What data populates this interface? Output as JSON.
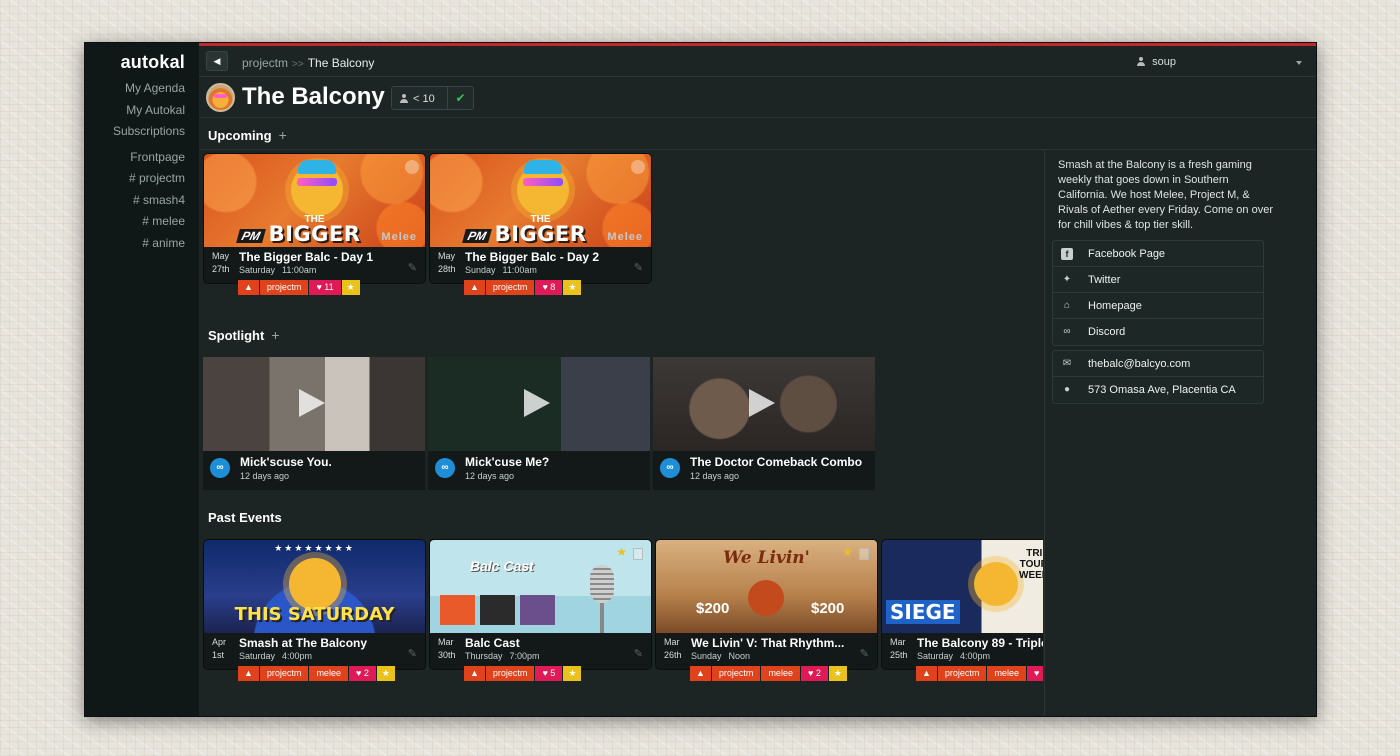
{
  "sidebar": {
    "logo": "autokal",
    "nav": [
      "My Agenda",
      "My Autokal",
      "Subscriptions"
    ],
    "front": "Frontpage",
    "channels": [
      "# projectm",
      "# smash4",
      "# melee",
      "# anime"
    ]
  },
  "topbar": {
    "breadcrumb_parent": "projectm",
    "breadcrumb_sep": ">>",
    "breadcrumb_current": "The Balcony",
    "user": "soup"
  },
  "header": {
    "title": "The Balcony",
    "members": "< 10"
  },
  "sections": {
    "upcoming": "Upcoming",
    "spotlight": "Spotlight",
    "past": "Past Events",
    "plus": "+"
  },
  "upcoming": [
    {
      "month": "May",
      "day": "27th",
      "title": "The Bigger Balc - Day 1",
      "weekday": "Saturday",
      "time": "11:00am",
      "tags": [
        "projectm"
      ],
      "likes": "11"
    },
    {
      "month": "May",
      "day": "28th",
      "title": "The Bigger Balc - Day 2",
      "weekday": "Sunday",
      "time": "11:00am",
      "tags": [
        "projectm"
      ],
      "likes": "8"
    }
  ],
  "art_text": {
    "the": "THE",
    "bigger": "BIGGER",
    "pm": "PM",
    "melee": "Melee",
    "this_saturday": "THIS SATURDAY",
    "balc_cast": "Balc Cast",
    "we_livin": "We Livin'",
    "price": "$200",
    "siege": "SIEGE",
    "triple": "TRIPLE TOURNEY WEEKEND",
    "stars": "★★★★★★★★"
  },
  "spotlight": [
    {
      "title": "Mick'scuse You.",
      "age": "12 days ago"
    },
    {
      "title": "Mick'cuse Me?",
      "age": "12 days ago"
    },
    {
      "title": "The Doctor Comeback Combo",
      "age": "12 days ago"
    }
  ],
  "past": [
    {
      "month": "Apr",
      "day": "1st",
      "title": "Smash at The Balcony",
      "weekday": "Saturday",
      "time": "4:00pm",
      "tags": [
        "projectm",
        "melee"
      ],
      "likes": "2"
    },
    {
      "month": "Mar",
      "day": "30th",
      "title": "Balc Cast",
      "weekday": "Thursday",
      "time": "7:00pm",
      "tags": [
        "projectm"
      ],
      "likes": "5"
    },
    {
      "month": "Mar",
      "day": "26th",
      "title": "We Livin' V: That Rhythm...",
      "weekday": "Sunday",
      "time": "Noon",
      "tags": [
        "projectm",
        "melee"
      ],
      "likes": "2"
    },
    {
      "month": "Mar",
      "day": "25th",
      "title": "The Balcony 89 - Triple",
      "weekday": "Saturday",
      "time": "4:00pm",
      "tags": [
        "projectm",
        "melee"
      ],
      "likes": ""
    }
  ],
  "about": "Smash at the Balcony is a fresh gaming weekly that goes down in Southern California. We host Melee, Project M, & Rivals of Aether every Friday. Come on over for chill vibes & top tier skill.",
  "links": [
    "Facebook Page",
    "Twitter",
    "Homepage",
    "Discord"
  ],
  "contact": {
    "email": "thebalc@balcyo.com",
    "address": "573 Omasa Ave, Placentia CA"
  },
  "colors": {
    "accent_red": "#c4272b",
    "tag_orange": "#e0421c",
    "tag_pink": "#e01a57",
    "tag_yellow": "#e9c21b",
    "check_green": "#3bbd59"
  }
}
